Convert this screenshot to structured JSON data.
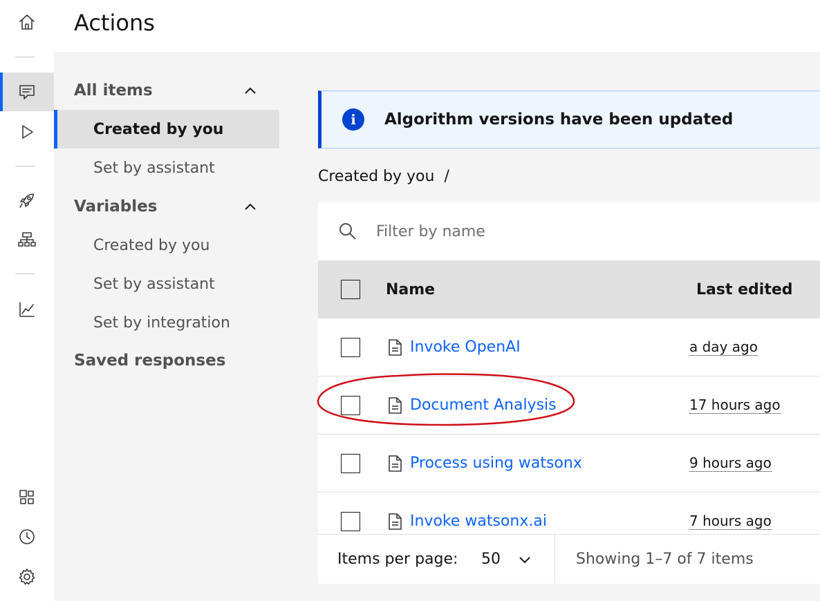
{
  "header": {
    "title": "Actions"
  },
  "rail": {
    "icons": [
      "home-icon",
      "chat-icon",
      "play-icon",
      "rocket-icon",
      "flow-icon",
      "analytics-icon",
      "integrations-icon",
      "history-icon",
      "settings-icon"
    ],
    "active": "chat-icon",
    "accent": "#0f62fe"
  },
  "sidenav": {
    "all_items": "All items",
    "created_by_you": "Created by you",
    "set_by_assistant": "Set by assistant",
    "variables": "Variables",
    "var_created_by_you": "Created by you",
    "var_set_by_assistant": "Set by assistant",
    "var_set_by_integration": "Set by integration",
    "saved_responses": "Saved responses"
  },
  "notification": {
    "text": "Algorithm versions have been updated",
    "icon": "info-icon"
  },
  "breadcrumb": {
    "label": "Created by you",
    "separator": "/"
  },
  "search": {
    "placeholder": "Filter by name"
  },
  "table": {
    "headers": {
      "name": "Name",
      "last_edited": "Last edited"
    },
    "rows": [
      {
        "name": "Invoke OpenAI",
        "last_edited": "a day ago"
      },
      {
        "name": "Document Analysis",
        "last_edited": "17 hours ago"
      },
      {
        "name": "Process using watsonx",
        "last_edited": "9 hours ago"
      },
      {
        "name": "Invoke watsonx.ai",
        "last_edited": "7 hours ago"
      }
    ]
  },
  "pagination": {
    "items_per_page_label": "Items per page:",
    "items_per_page": "50",
    "status": "Showing 1–7 of 7 items"
  },
  "annotation": {
    "color": "#d0101a",
    "target": "Document Analysis"
  }
}
